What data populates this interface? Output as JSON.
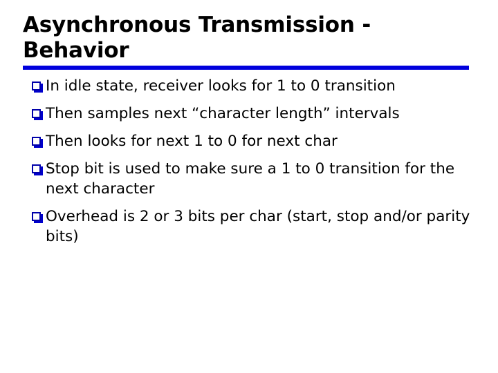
{
  "slide": {
    "title": "Asynchronous Transmission -\nBehavior",
    "title_line_1": "Asynchronous Transmission -",
    "title_line_2": "Behavior",
    "divider_color": "#0000DD",
    "background_color": "#ffffff",
    "text_color": "#000000",
    "bullet_marker_color": "#0000CC",
    "bullet_glyph": "open-square",
    "bullets": [
      {
        "text": "In idle state, receiver looks for 1 to 0 transition"
      },
      {
        "text": "Then samples next “character length” intervals"
      },
      {
        "text": "Then looks for next 1 to 0 for next char"
      },
      {
        "text": "Stop bit is used to make sure a 1 to 0 transition for the next character"
      },
      {
        "text": "Overhead is 2 or 3 bits per char (start, stop and/or parity bits)"
      }
    ]
  }
}
